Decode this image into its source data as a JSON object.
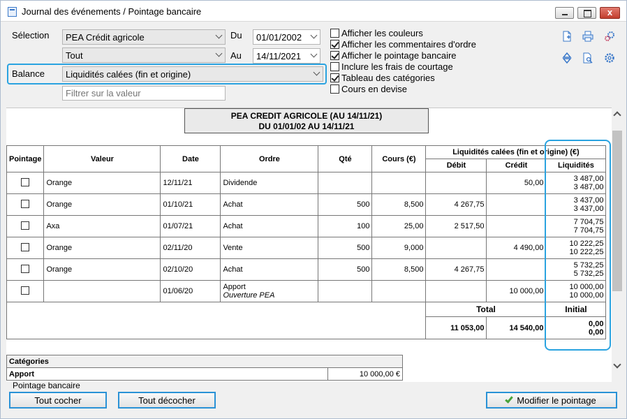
{
  "window": {
    "title": "Journal des événements / Pointage bancaire",
    "close_glyph": "x"
  },
  "filters": {
    "selection_label": "Sélection",
    "portfolio": "PEA Crédit agricole",
    "type": "Tout",
    "balance_label": "Balance",
    "balance": "Liquidités calées (fin et origine)",
    "filter_placeholder": "Filtrer sur la valeur",
    "du_label": "Du",
    "date_from": "01/01/2002",
    "au_label": "Au",
    "date_to": "14/11/2021"
  },
  "options": [
    {
      "label": "Afficher les couleurs",
      "checked": false
    },
    {
      "label": "Afficher les commentaires d'ordre",
      "checked": true
    },
    {
      "label": "Afficher le pointage bancaire",
      "checked": true
    },
    {
      "label": "Inclure les frais de courtage",
      "checked": false
    },
    {
      "label": "Tableau des catégories",
      "checked": true
    },
    {
      "label": "Cours en devise",
      "checked": false
    }
  ],
  "toolbar_icons": [
    "new-document-icon",
    "print-icon",
    "settings-gears-icon",
    "sort-updown-icon",
    "document-search-icon",
    "gear-icon"
  ],
  "report": {
    "title_line1": "PEA CREDIT AGRICOLE (AU 14/11/21)",
    "title_line2": "DU 01/01/02 AU 14/11/21"
  },
  "table": {
    "headers": {
      "pointage": "Pointage",
      "valeur": "Valeur",
      "date": "Date",
      "ordre": "Ordre",
      "qte": "Qté",
      "cours": "Cours (€)",
      "group": "Liquidités calées (fin et origine) (€)",
      "debit": "Débit",
      "credit": "Crédit",
      "liquidites": "Liquidités"
    },
    "rows": [
      {
        "valeur": "Orange",
        "date": "12/11/21",
        "ordre": "Dividende",
        "comment": "",
        "qte": "",
        "cours": "",
        "debit": "",
        "credit": "50,00",
        "liq1": "3 487,00",
        "liq2": "3 487,00"
      },
      {
        "valeur": "Orange",
        "date": "01/10/21",
        "ordre": "Achat",
        "comment": "",
        "qte": "500",
        "cours": "8,500",
        "debit": "4 267,75",
        "credit": "",
        "liq1": "3 437,00",
        "liq2": "3 437,00"
      },
      {
        "valeur": "Axa",
        "date": "01/07/21",
        "ordre": "Achat",
        "comment": "",
        "qte": "100",
        "cours": "25,00",
        "debit": "2 517,50",
        "credit": "",
        "liq1": "7 704,75",
        "liq2": "7 704,75"
      },
      {
        "valeur": "Orange",
        "date": "02/11/20",
        "ordre": "Vente",
        "comment": "",
        "qte": "500",
        "cours": "9,000",
        "debit": "",
        "credit": "4 490,00",
        "liq1": "10 222,25",
        "liq2": "10 222,25"
      },
      {
        "valeur": "Orange",
        "date": "02/10/20",
        "ordre": "Achat",
        "comment": "",
        "qte": "500",
        "cours": "8,500",
        "debit": "4 267,75",
        "credit": "",
        "liq1": "5 732,25",
        "liq2": "5 732,25"
      },
      {
        "valeur": "",
        "date": "01/06/20",
        "ordre": "Apport",
        "comment": "Ouverture PEA",
        "qte": "",
        "cours": "",
        "debit": "",
        "credit": "10 000,00",
        "liq1": "10 000,00",
        "liq2": "10 000,00"
      }
    ],
    "total_label": "Total",
    "initial_label": "Initial",
    "total_debit": "11 053,00",
    "total_credit": "14 540,00",
    "initial1": "0,00",
    "initial2": "0,00"
  },
  "categories": {
    "header": "Catégories",
    "rows": [
      {
        "label": "Apport",
        "value": "10 000,00 €"
      }
    ]
  },
  "footer": {
    "section_label": "Pointage bancaire",
    "check_all": "Tout cocher",
    "uncheck_all": "Tout décocher",
    "modify": "Modifier le pointage"
  },
  "colors": {
    "highlight": "#2aa3e0",
    "button_border": "#2a92d6",
    "check_green": "#48a33a"
  }
}
